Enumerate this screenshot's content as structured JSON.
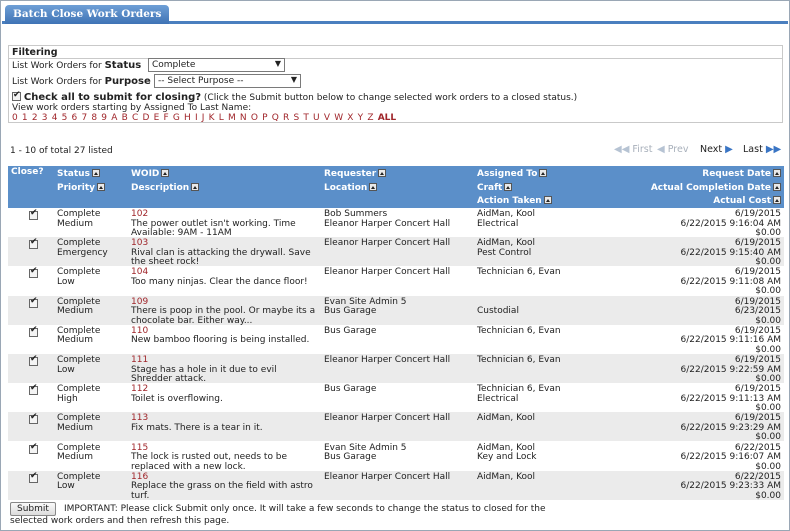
{
  "tab": {
    "label": "Batch Close Work Orders"
  },
  "filtering": {
    "title": "Filtering",
    "status_prefix": "List Work Orders for ",
    "status_word": "Status",
    "status_value": "Complete",
    "purpose_prefix": "List Work Orders for ",
    "purpose_word": "Purpose",
    "purpose_value": "-- Select Purpose --",
    "check_all_label": "Check all to submit for closing?",
    "check_all_note": " (Click the Submit button below to change selected work orders to a closed status.)",
    "view_label": "View work orders starting by Assigned To Last Name:",
    "letters": [
      "0",
      "1",
      "2",
      "3",
      "4",
      "5",
      "6",
      "7",
      "8",
      "9",
      "A",
      "B",
      "C",
      "D",
      "E",
      "F",
      "G",
      "H",
      "I",
      "J",
      "K",
      "L",
      "M",
      "N",
      "O",
      "P",
      "Q",
      "R",
      "S",
      "T",
      "U",
      "V",
      "W",
      "X",
      "Y",
      "Z"
    ],
    "all_label": "ALL"
  },
  "listing": {
    "count_text": "1 - 10 of total 27 listed",
    "first": "First",
    "prev": "Prev",
    "next": "Next",
    "last": "Last"
  },
  "columns": {
    "close": "Close?",
    "status": "Status",
    "priority": "Priority",
    "woid": "WOID",
    "description": "Description",
    "requester": "Requester",
    "location": "Location",
    "assigned_to": "Assigned To",
    "craft": "Craft",
    "action_taken": "Action Taken",
    "request_date": "Request Date",
    "actual_completion_date": "Actual Completion Date",
    "actual_cost": "Actual Cost"
  },
  "rows": [
    {
      "status": "Complete",
      "priority": "Medium",
      "woid": "102",
      "desc1": "The power outlet isn't working. Time",
      "desc2": "Available: 9AM - 11AM",
      "requester": "Bob Summers",
      "location": "Eleanor Harper Concert Hall",
      "assigned": "AidMan, Kool",
      "craft": "Electrical",
      "action": "",
      "request_date": "6/19/2015",
      "completion_date": "6/22/2015 9:16:04 AM",
      "cost": "$0.00"
    },
    {
      "status": "Complete",
      "priority": "Emergency",
      "woid": "103",
      "desc1": "Rival clan is attacking the drywall. Save",
      "desc2": "the sheet rock!",
      "requester": "Eleanor Harper Concert Hall",
      "location": "",
      "assigned": "AidMan, Kool",
      "craft": "Pest Control",
      "action": "",
      "request_date": "6/19/2015",
      "completion_date": "6/22/2015 9:15:40 AM",
      "cost": "$0.00"
    },
    {
      "status": "Complete",
      "priority": "Low",
      "woid": "104",
      "desc1": "Too many ninjas. Clear the dance floor!",
      "desc2": "",
      "requester": "Eleanor Harper Concert Hall",
      "location": "",
      "assigned": "Technician 6, Evan",
      "craft": "",
      "action": "",
      "request_date": "6/19/2015",
      "completion_date": "6/22/2015 9:11:08 AM",
      "cost": "$0.00"
    },
    {
      "status": "Complete",
      "priority": "Medium",
      "woid": "109",
      "desc1": "There is poop in the pool. Or maybe its a",
      "desc2": "chocolate bar. Either way...",
      "requester": "Evan Site Admin 5",
      "location": "Bus Garage",
      "assigned": "",
      "craft": "Custodial",
      "action": "",
      "request_date": "6/19/2015",
      "completion_date": "6/23/2015",
      "cost": "$0.00"
    },
    {
      "status": "Complete",
      "priority": "Medium",
      "woid": "110",
      "desc1": "New bamboo flooring is being installed.",
      "desc2": "",
      "requester": "Bus Garage",
      "location": "",
      "assigned": "Technician 6, Evan",
      "craft": "",
      "action": "",
      "request_date": "6/19/2015",
      "completion_date": "6/22/2015 9:11:16 AM",
      "cost": "$0.00"
    },
    {
      "status": "Complete",
      "priority": "Low",
      "woid": "111",
      "desc1": "Stage has a hole in it due to evil",
      "desc2": "Shredder attack.",
      "requester": "Eleanor Harper Concert Hall",
      "location": "",
      "assigned": "Technician 6, Evan",
      "craft": "",
      "action": "",
      "request_date": "6/19/2015",
      "completion_date": "6/22/2015 9:22:59 AM",
      "cost": "$0.00"
    },
    {
      "status": "Complete",
      "priority": "High",
      "woid": "112",
      "desc1": "Toilet is overflowing.",
      "desc2": "",
      "requester": "Bus Garage",
      "location": "",
      "assigned": "Technician 6, Evan",
      "craft": "Electrical",
      "action": "",
      "request_date": "6/19/2015",
      "completion_date": "6/22/2015 9:11:13 AM",
      "cost": "$0.00"
    },
    {
      "status": "Complete",
      "priority": "Medium",
      "woid": "113",
      "desc1": "Fix mats. There is a tear in it.",
      "desc2": "",
      "requester": "Eleanor Harper Concert Hall",
      "location": "",
      "assigned": "AidMan, Kool",
      "craft": "",
      "action": "",
      "request_date": "6/19/2015",
      "completion_date": "6/22/2015 9:23:29 AM",
      "cost": "$0.00"
    },
    {
      "status": "Complete",
      "priority": "Medium",
      "woid": "115",
      "desc1": "The lock is rusted out, needs to be",
      "desc2": "replaced with a new lock.",
      "requester": "Evan Site Admin 5",
      "location": "Bus Garage",
      "assigned": "AidMan, Kool",
      "craft": "Key and Lock",
      "action": "",
      "request_date": "6/22/2015",
      "completion_date": "6/22/2015 9:16:07 AM",
      "cost": "$0.00"
    },
    {
      "status": "Complete",
      "priority": "Low",
      "woid": "116",
      "desc1": "Replace the grass on the field with astro",
      "desc2": "turf.",
      "requester": "Eleanor Harper Concert Hall",
      "location": "",
      "assigned": "AidMan, Kool",
      "craft": "",
      "action": "",
      "request_date": "6/22/2015",
      "completion_date": "6/22/2015 9:23:33 AM",
      "cost": "$0.00"
    }
  ],
  "footer": {
    "submit_label": "Submit",
    "important_line1": "IMPORTANT: Please click Submit only once.  It will take a few seconds to change the status to closed for the",
    "important_line2": "selected work orders and then refresh this page."
  }
}
